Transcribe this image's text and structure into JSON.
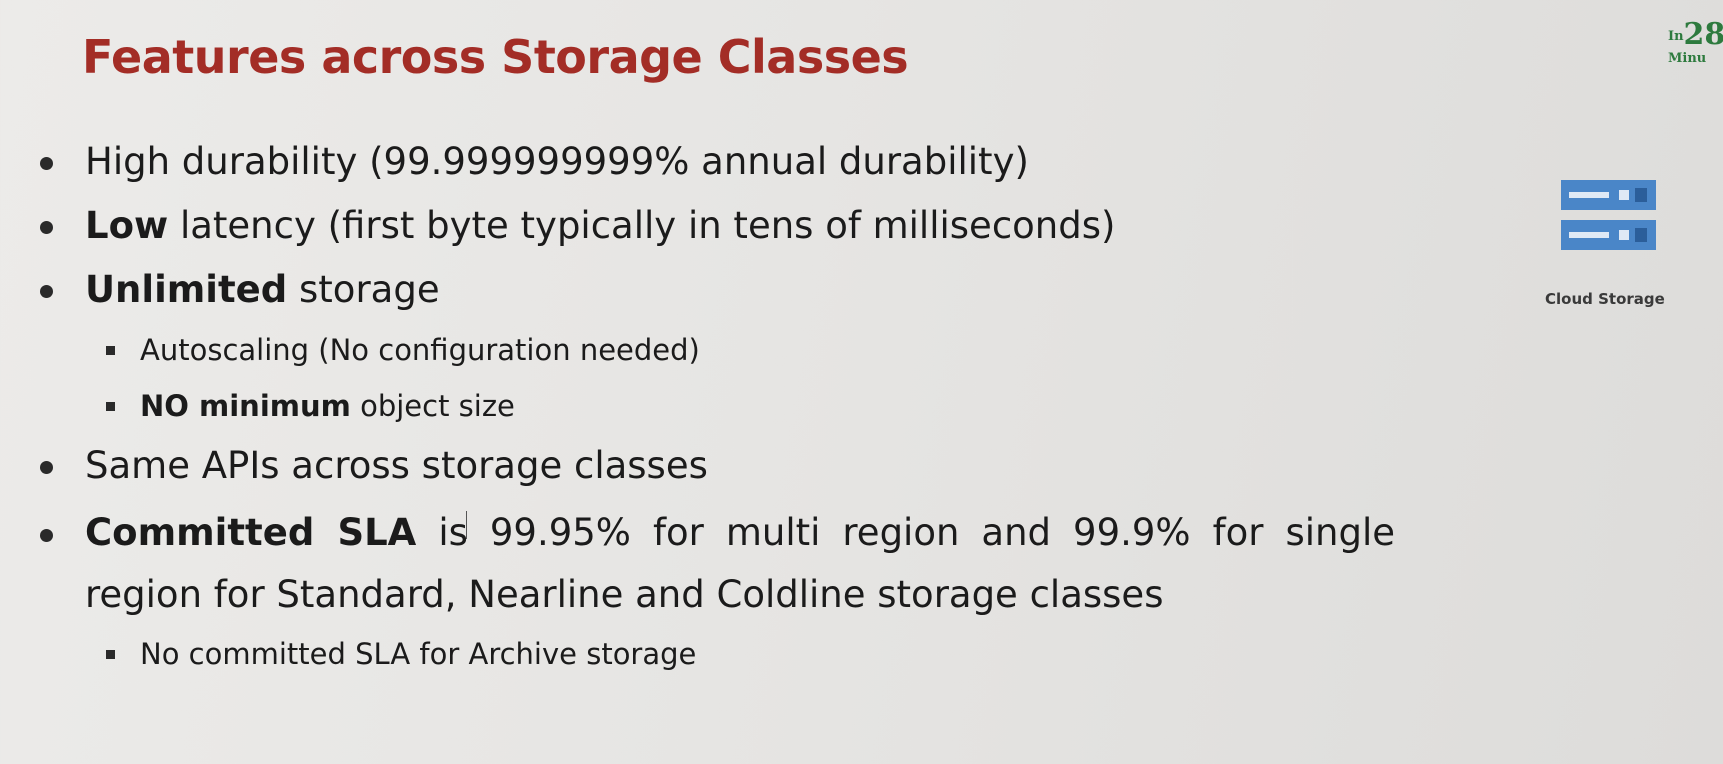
{
  "slide": {
    "title": "Features across Storage Classes",
    "bullets": [
      {
        "bold": "",
        "text": "High durability (99.999999999% annual durability)"
      },
      {
        "bold": "Low",
        "text": " latency (first byte typically in tens of milliseconds)"
      },
      {
        "bold": "Unlimited",
        "text": " storage",
        "subs": [
          {
            "bold": "",
            "text": "Autoscaling (No configuration needed)"
          },
          {
            "bold": "NO minimum",
            "text": " object size"
          }
        ]
      },
      {
        "bold": "",
        "text": "Same APIs across storage classes"
      },
      {
        "bold": "Committed SLA",
        "text_before_cursor": " is",
        "text": " 99.95% for multi region and 99.9% for single region for Standard, Nearline and Coldline storage classes",
        "subs": [
          {
            "bold": "",
            "text": "No committed SLA for Archive storage"
          }
        ]
      }
    ]
  },
  "sidebar": {
    "icon": "cloud-storage-icon",
    "caption": "Cloud Storage",
    "icon_color": "#4a86c8"
  },
  "logo": {
    "prefix": "In",
    "number": "28",
    "unit": "Minu"
  },
  "colors": {
    "title": "#a32d26",
    "text": "#1b1b1b",
    "logo": "#2d7a3e"
  }
}
